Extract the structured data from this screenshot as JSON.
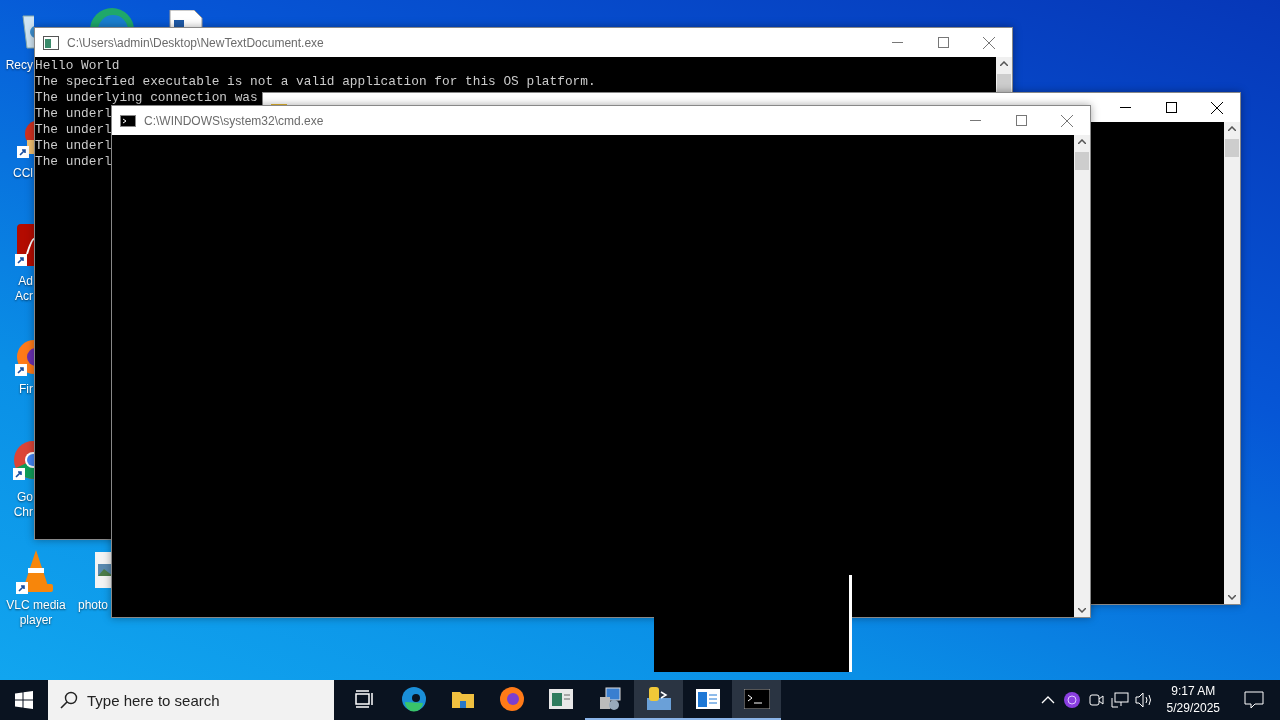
{
  "desktop_icons": [
    {
      "kind": "recycle-bin",
      "label_lines": [
        "Recy"
      ],
      "shortcut": false
    },
    {
      "kind": "ccleaner",
      "label_lines": [
        "CCl"
      ],
      "shortcut": true
    },
    {
      "kind": "acrobat",
      "label_lines": [
        "Ad",
        "Acr"
      ],
      "shortcut": true
    },
    {
      "kind": "firefox",
      "label_lines": [
        "Fir"
      ],
      "shortcut": true
    },
    {
      "kind": "chrome",
      "label_lines": [
        "Go",
        "Chr"
      ],
      "shortcut": true
    },
    {
      "kind": "vlc",
      "label_lines": [
        "VLC media",
        "player"
      ],
      "shortcut": true
    },
    {
      "kind": "photo",
      "label_lines": [
        "photo"
      ],
      "shortcut": false
    }
  ],
  "windows": [
    {
      "title": "C:\\Users\\admin\\Desktop\\NewTextDocument.exe",
      "active": false,
      "kind": "app",
      "lines": [
        "Hello World",
        "The specified executable is not a valid application for this OS platform.",
        "The underlying connection was",
        "The underl",
        "The underl",
        "The underl",
        "The underl"
      ]
    },
    {
      "active": true,
      "kind": "folder"
    },
    {
      "title": "C:\\WINDOWS\\system32\\cmd.exe",
      "active": false,
      "kind": "console"
    }
  ],
  "taskbar": {
    "search": {
      "placeholder": "Type here to search"
    },
    "apps": [
      {
        "kind": "task-view",
        "running": false,
        "selected": false
      },
      {
        "kind": "edge",
        "running": false,
        "selected": false
      },
      {
        "kind": "folder",
        "running": false,
        "selected": false
      },
      {
        "kind": "firefox",
        "running": false,
        "selected": false
      },
      {
        "kind": "app",
        "running": false,
        "selected": false
      },
      {
        "kind": "installer",
        "running": true,
        "selected": false
      },
      {
        "kind": "python",
        "running": true,
        "selected": true
      },
      {
        "kind": "document",
        "running": true,
        "selected": false
      },
      {
        "kind": "console",
        "running": true,
        "selected": true
      }
    ],
    "clock": {
      "time": "9:17 AM",
      "date": "5/29/2025"
    }
  }
}
